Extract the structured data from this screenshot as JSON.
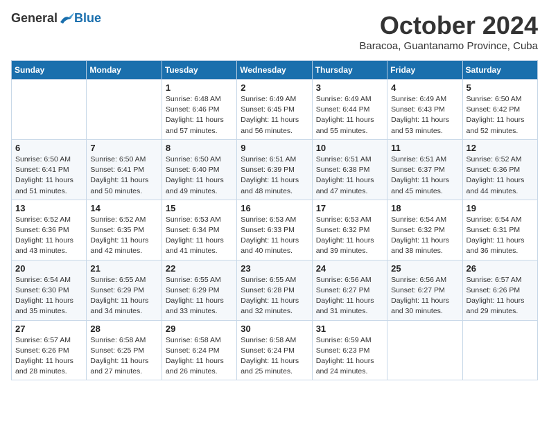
{
  "header": {
    "logo_general": "General",
    "logo_blue": "Blue",
    "month_title": "October 2024",
    "subtitle": "Baracoa, Guantanamo Province, Cuba"
  },
  "calendar": {
    "days_of_week": [
      "Sunday",
      "Monday",
      "Tuesday",
      "Wednesday",
      "Thursday",
      "Friday",
      "Saturday"
    ],
    "weeks": [
      [
        {
          "day": "",
          "detail": ""
        },
        {
          "day": "",
          "detail": ""
        },
        {
          "day": "1",
          "detail": "Sunrise: 6:48 AM\nSunset: 6:46 PM\nDaylight: 11 hours and 57 minutes."
        },
        {
          "day": "2",
          "detail": "Sunrise: 6:49 AM\nSunset: 6:45 PM\nDaylight: 11 hours and 56 minutes."
        },
        {
          "day": "3",
          "detail": "Sunrise: 6:49 AM\nSunset: 6:44 PM\nDaylight: 11 hours and 55 minutes."
        },
        {
          "day": "4",
          "detail": "Sunrise: 6:49 AM\nSunset: 6:43 PM\nDaylight: 11 hours and 53 minutes."
        },
        {
          "day": "5",
          "detail": "Sunrise: 6:50 AM\nSunset: 6:42 PM\nDaylight: 11 hours and 52 minutes."
        }
      ],
      [
        {
          "day": "6",
          "detail": "Sunrise: 6:50 AM\nSunset: 6:41 PM\nDaylight: 11 hours and 51 minutes."
        },
        {
          "day": "7",
          "detail": "Sunrise: 6:50 AM\nSunset: 6:41 PM\nDaylight: 11 hours and 50 minutes."
        },
        {
          "day": "8",
          "detail": "Sunrise: 6:50 AM\nSunset: 6:40 PM\nDaylight: 11 hours and 49 minutes."
        },
        {
          "day": "9",
          "detail": "Sunrise: 6:51 AM\nSunset: 6:39 PM\nDaylight: 11 hours and 48 minutes."
        },
        {
          "day": "10",
          "detail": "Sunrise: 6:51 AM\nSunset: 6:38 PM\nDaylight: 11 hours and 47 minutes."
        },
        {
          "day": "11",
          "detail": "Sunrise: 6:51 AM\nSunset: 6:37 PM\nDaylight: 11 hours and 45 minutes."
        },
        {
          "day": "12",
          "detail": "Sunrise: 6:52 AM\nSunset: 6:36 PM\nDaylight: 11 hours and 44 minutes."
        }
      ],
      [
        {
          "day": "13",
          "detail": "Sunrise: 6:52 AM\nSunset: 6:36 PM\nDaylight: 11 hours and 43 minutes."
        },
        {
          "day": "14",
          "detail": "Sunrise: 6:52 AM\nSunset: 6:35 PM\nDaylight: 11 hours and 42 minutes."
        },
        {
          "day": "15",
          "detail": "Sunrise: 6:53 AM\nSunset: 6:34 PM\nDaylight: 11 hours and 41 minutes."
        },
        {
          "day": "16",
          "detail": "Sunrise: 6:53 AM\nSunset: 6:33 PM\nDaylight: 11 hours and 40 minutes."
        },
        {
          "day": "17",
          "detail": "Sunrise: 6:53 AM\nSunset: 6:32 PM\nDaylight: 11 hours and 39 minutes."
        },
        {
          "day": "18",
          "detail": "Sunrise: 6:54 AM\nSunset: 6:32 PM\nDaylight: 11 hours and 38 minutes."
        },
        {
          "day": "19",
          "detail": "Sunrise: 6:54 AM\nSunset: 6:31 PM\nDaylight: 11 hours and 36 minutes."
        }
      ],
      [
        {
          "day": "20",
          "detail": "Sunrise: 6:54 AM\nSunset: 6:30 PM\nDaylight: 11 hours and 35 minutes."
        },
        {
          "day": "21",
          "detail": "Sunrise: 6:55 AM\nSunset: 6:29 PM\nDaylight: 11 hours and 34 minutes."
        },
        {
          "day": "22",
          "detail": "Sunrise: 6:55 AM\nSunset: 6:29 PM\nDaylight: 11 hours and 33 minutes."
        },
        {
          "day": "23",
          "detail": "Sunrise: 6:55 AM\nSunset: 6:28 PM\nDaylight: 11 hours and 32 minutes."
        },
        {
          "day": "24",
          "detail": "Sunrise: 6:56 AM\nSunset: 6:27 PM\nDaylight: 11 hours and 31 minutes."
        },
        {
          "day": "25",
          "detail": "Sunrise: 6:56 AM\nSunset: 6:27 PM\nDaylight: 11 hours and 30 minutes."
        },
        {
          "day": "26",
          "detail": "Sunrise: 6:57 AM\nSunset: 6:26 PM\nDaylight: 11 hours and 29 minutes."
        }
      ],
      [
        {
          "day": "27",
          "detail": "Sunrise: 6:57 AM\nSunset: 6:26 PM\nDaylight: 11 hours and 28 minutes."
        },
        {
          "day": "28",
          "detail": "Sunrise: 6:58 AM\nSunset: 6:25 PM\nDaylight: 11 hours and 27 minutes."
        },
        {
          "day": "29",
          "detail": "Sunrise: 6:58 AM\nSunset: 6:24 PM\nDaylight: 11 hours and 26 minutes."
        },
        {
          "day": "30",
          "detail": "Sunrise: 6:58 AM\nSunset: 6:24 PM\nDaylight: 11 hours and 25 minutes."
        },
        {
          "day": "31",
          "detail": "Sunrise: 6:59 AM\nSunset: 6:23 PM\nDaylight: 11 hours and 24 minutes."
        },
        {
          "day": "",
          "detail": ""
        },
        {
          "day": "",
          "detail": ""
        }
      ]
    ]
  }
}
